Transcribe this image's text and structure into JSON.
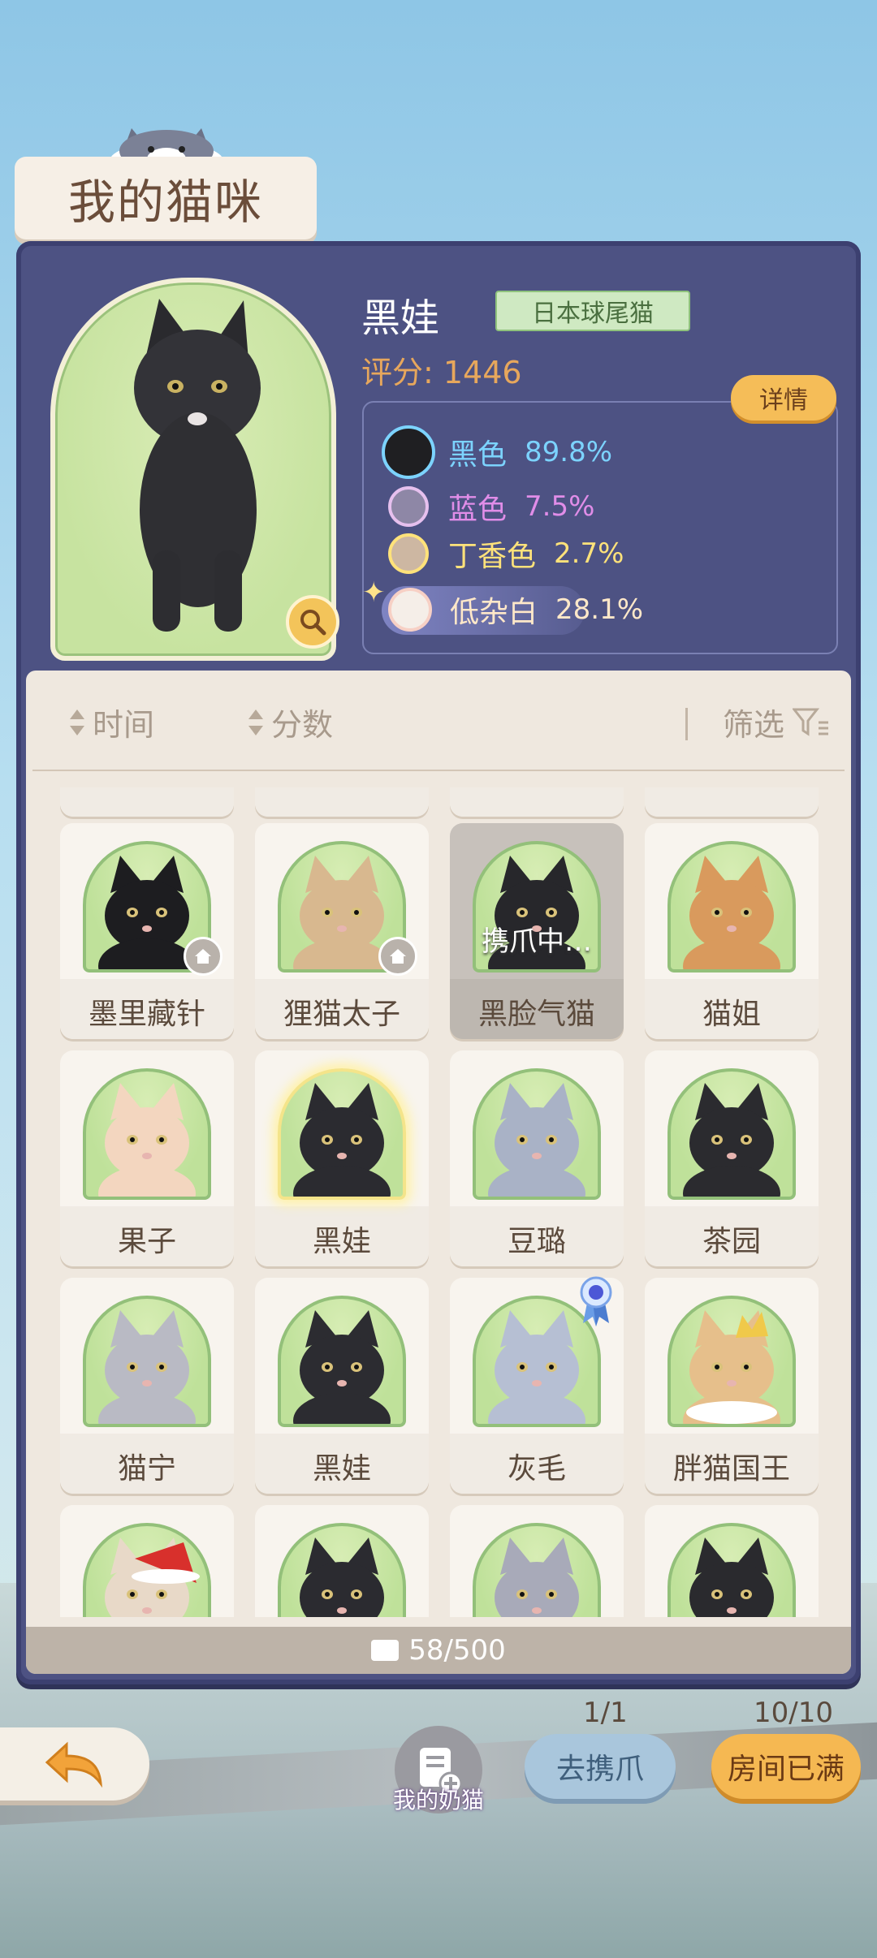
{
  "title": "我的猫咪",
  "selected_cat": {
    "name": "黑娃",
    "breed": "日本球尾猫",
    "score_label": "评分: 1446",
    "detail_button": "详情",
    "genes": [
      {
        "name": "黑色",
        "pct": "89.8%",
        "color": "#1f1f22",
        "text_color": "#7cd3ff"
      },
      {
        "name": "蓝色",
        "pct": "7.5%",
        "color": "#8e87a6",
        "text_color": "#e08de8"
      },
      {
        "name": "丁香色",
        "pct": "2.7%",
        "color": "#cdb7a2",
        "text_color": "#ffe27a"
      },
      {
        "name": "低杂白",
        "pct": "28.1%",
        "color": "#f5eee8",
        "text_color": "#ffe8c9"
      }
    ]
  },
  "sort_bar": {
    "time_label": "时间",
    "score_label": "分数",
    "filter_label": "筛选"
  },
  "cat_grid": {
    "rows": [
      [
        {
          "name": "墨里藏针",
          "home": true,
          "busy": false,
          "fur": "#1d1d20"
        },
        {
          "name": "狸猫太子",
          "home": true,
          "busy": false,
          "fur": "#d8b88f"
        },
        {
          "name": "黑脸气猫",
          "home": false,
          "busy": true,
          "busy_label": "携爪中…",
          "fur": "#27272b"
        },
        {
          "name": "猫姐",
          "home": false,
          "busy": false,
          "fur": "#d99a5d"
        }
      ],
      [
        {
          "name": "果子",
          "home": false,
          "busy": false,
          "fur": "#f3d6bf"
        },
        {
          "name": "黑娃",
          "home": false,
          "busy": false,
          "glow": true,
          "fur": "#2b2b30"
        },
        {
          "name": "豆璐",
          "home": false,
          "busy": false,
          "fur": "#a9b2c6"
        },
        {
          "name": "茶园",
          "home": false,
          "busy": false,
          "fur": "#2b2b2f"
        }
      ],
      [
        {
          "name": "猫宁",
          "home": false,
          "busy": false,
          "fur": "#b9bac4"
        },
        {
          "name": "黑娃",
          "home": false,
          "busy": false,
          "fur": "#2c2c31"
        },
        {
          "name": "灰毛",
          "home": false,
          "busy": false,
          "ribbon": true,
          "fur": "#b6bfd3"
        },
        {
          "name": "胖猫国王",
          "home": false,
          "busy": false,
          "crown": true,
          "fur": "#e6bf8b"
        }
      ],
      [
        {
          "name": "",
          "home": false,
          "busy": false,
          "hat": true,
          "fur": "#e8d9c8"
        },
        {
          "name": "",
          "home": false,
          "busy": false,
          "fur": "#2b2b30"
        },
        {
          "name": "",
          "home": false,
          "busy": false,
          "fur": "#a8aab9"
        },
        {
          "name": "",
          "home": false,
          "busy": false,
          "fur": "#2a2a2e"
        }
      ]
    ]
  },
  "inventory_count": "58/500",
  "bottom": {
    "my_milk_cat_label": "我的奶猫",
    "claw_count": "1/1",
    "claw_button": "去携爪",
    "room_count": "10/10",
    "room_button": "房间已满"
  }
}
